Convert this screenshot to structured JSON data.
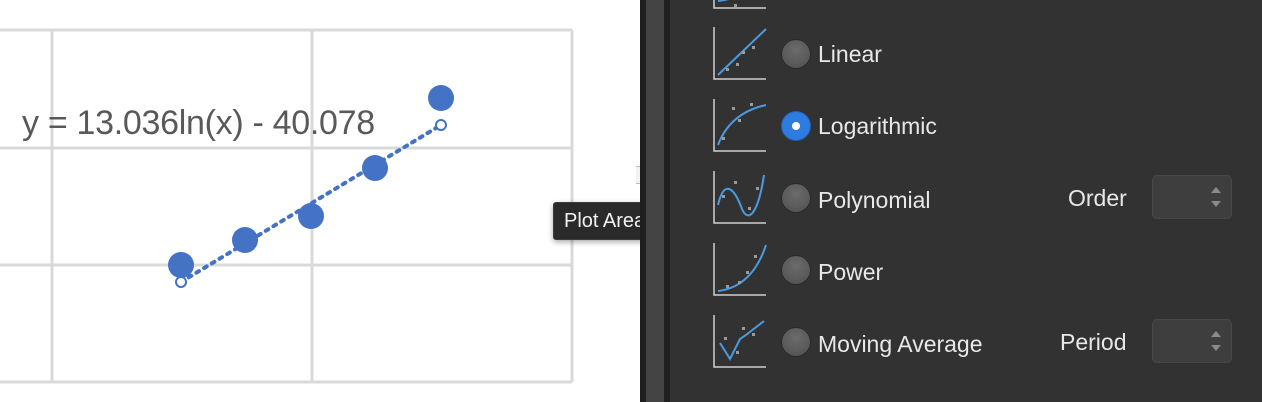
{
  "chart": {
    "trendline_equation": "y = 13.036ln(x) - 40.078",
    "marker_color": "#4472C4",
    "gridline_color": "#d9d9d9"
  },
  "tooltip": {
    "text": "Plot Area"
  },
  "trendline_options": {
    "items": [
      {
        "name": "Linear",
        "thumb": "linear-trendline-icon",
        "selected": false
      },
      {
        "name": "Logarithmic",
        "thumb": "logarithmic-trendline-icon",
        "selected": true
      },
      {
        "name": "Polynomial",
        "thumb": "polynomial-trendline-icon",
        "selected": false,
        "param_label": "Order",
        "param_value": ""
      },
      {
        "name": "Power",
        "thumb": "power-trendline-icon",
        "selected": false
      },
      {
        "name": "Moving Average",
        "thumb": "moving-average-trendline-icon",
        "selected": false,
        "param_label": "Period",
        "param_value": ""
      }
    ],
    "accent_color": "#2F7CE0"
  }
}
